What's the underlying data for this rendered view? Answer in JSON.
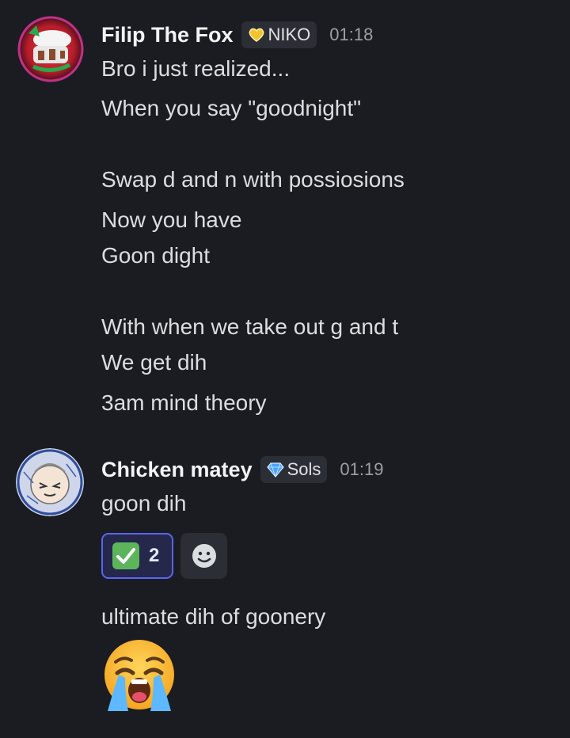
{
  "colors": {
    "background": "#1b1c21",
    "username": "#f2f3f5",
    "message_text": "#dbdee1",
    "timestamp": "#9c9fa8",
    "tag_background": "#2c2e35",
    "reaction_active_border": "#5865f2",
    "reaction_active_background": "#25284a"
  },
  "messages": [
    {
      "author": "Filip The Fox",
      "tag": {
        "icon": "gold-heart-badge-icon",
        "label": "NIKO"
      },
      "timestamp": "01:18",
      "avatar": "fox-avatar",
      "lines": [
        "Bro i just realized...",
        "When you say \"goodnight\"",
        "Swap d and n with possiosions",
        "Now you have",
        "Goon dight",
        "With when we take out g and t",
        "We get dih",
        "3am mind theory"
      ]
    },
    {
      "author": "Chicken matey",
      "tag": {
        "icon": "blue-diamond-badge-icon",
        "label": "Sols"
      },
      "timestamp": "01:19",
      "avatar": "sketch-face-avatar",
      "lines": [
        "goon dih"
      ],
      "reactions": [
        {
          "emoji": "check-mark-button-icon",
          "count": "2",
          "active": true
        },
        {
          "emoji": "add-reaction-icon",
          "add": true
        }
      ],
      "followups": [
        {
          "text": "ultimate dih of goonery"
        },
        {
          "emoji": "loudly-crying-face-icon"
        }
      ]
    }
  ]
}
